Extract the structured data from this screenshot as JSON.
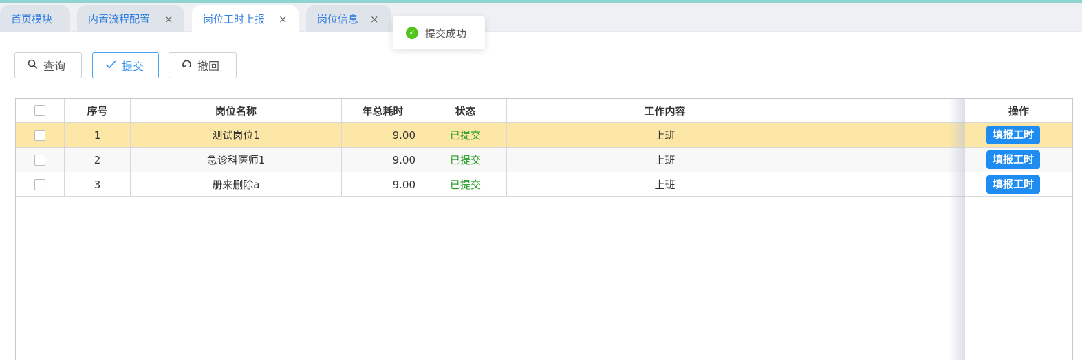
{
  "tabs": [
    {
      "label": "首页模块",
      "closable": false,
      "active": false
    },
    {
      "label": "内置流程配置",
      "closable": true,
      "active": false
    },
    {
      "label": "岗位工时上报",
      "closable": true,
      "active": true
    },
    {
      "label": "岗位信息",
      "closable": true,
      "active": false
    }
  ],
  "close_glyph": "×",
  "toast": {
    "icon": "check-circle-icon",
    "text": "提交成功",
    "color": "#52c41a"
  },
  "toolbar": {
    "query_label": "查询",
    "submit_label": "提交",
    "withdraw_label": "撤回"
  },
  "table": {
    "headers": {
      "seq": "序号",
      "post_name": "岗位名称",
      "annual_hours": "年总耗时",
      "status": "状态",
      "work_content": "工作内容",
      "extra": "",
      "actions": "操作"
    },
    "rows": [
      {
        "seq": "1",
        "post_name": "测试岗位1",
        "annual_hours": "9.00",
        "status": "已提交",
        "work_content": "上班",
        "action": "填报工时"
      },
      {
        "seq": "2",
        "post_name": "急诊科医师1",
        "annual_hours": "9.00",
        "status": "已提交",
        "work_content": "上班",
        "action": "填报工时"
      },
      {
        "seq": "3",
        "post_name": "册来删除a",
        "annual_hours": "9.00",
        "status": "已提交",
        "work_content": "上班",
        "action": "填报工时"
      }
    ]
  },
  "colors": {
    "accent": "#2a8ff0",
    "selected_row": "#fde7a7",
    "status_green": "#1e9a1e"
  }
}
